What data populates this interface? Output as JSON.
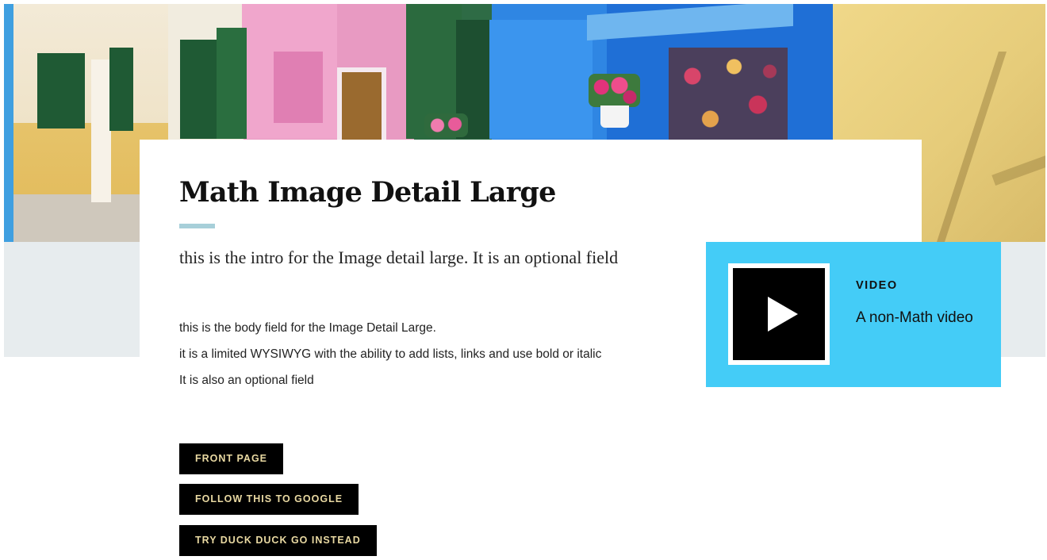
{
  "hero": {
    "description_icon": "photo"
  },
  "article": {
    "title": "Math Image Detail Large",
    "intro": "this is the intro for the Image detail large. It is an optional field",
    "body_paragraphs": [
      "this is the body field for the Image Detail Large.",
      "it is a limited WYSIWYG with the ability to add lists, links and use bold or italic",
      "It is also an optional field"
    ],
    "buttons": [
      {
        "label": "FRONT PAGE"
      },
      {
        "label": "FOLLOW THIS TO GOOGLE"
      },
      {
        "label": "TRY DUCK DUCK GO INSTEAD"
      }
    ]
  },
  "video": {
    "label": "VIDEO",
    "title": "A non-Math video",
    "icon": "play-icon"
  },
  "colors": {
    "accent_line": "#a7cfd9",
    "video_card": "#44ccf7",
    "button_bg": "#000000",
    "button_text": "#e9d9a2",
    "band": "#e7ecee"
  }
}
